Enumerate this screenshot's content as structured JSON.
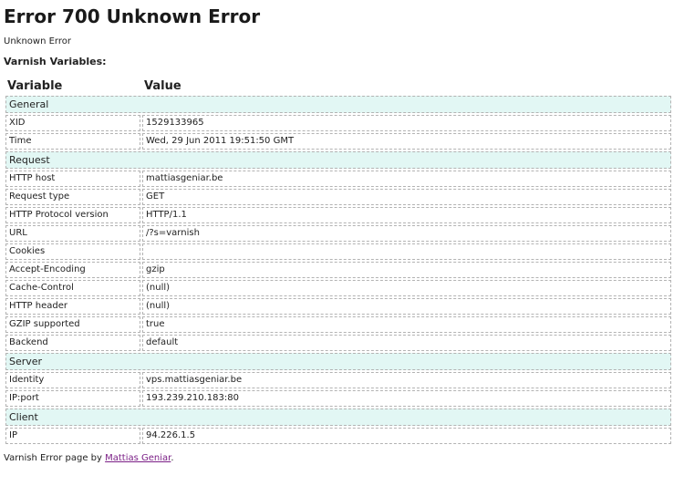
{
  "title": "Error 700 Unknown Error",
  "subtitle": "Unknown Error",
  "vars_heading": "Varnish Variables:",
  "columns": {
    "variable": "Variable",
    "value": "Value"
  },
  "sections": [
    {
      "name": "General",
      "rows": [
        {
          "key": "XID",
          "value": "1529133965"
        },
        {
          "key": "Time",
          "value": "Wed, 29 Jun 2011 19:51:50 GMT"
        }
      ]
    },
    {
      "name": "Request",
      "rows": [
        {
          "key": "HTTP host",
          "value": "mattiasgeniar.be"
        },
        {
          "key": "Request type",
          "value": "GET"
        },
        {
          "key": "HTTP Protocol version",
          "value": "HTTP/1.1"
        },
        {
          "key": "URL",
          "value": "/?s=varnish"
        },
        {
          "key": "Cookies",
          "value": ""
        },
        {
          "key": "Accept-Encoding",
          "value": "gzip"
        },
        {
          "key": "Cache-Control",
          "value": "(null)"
        },
        {
          "key": "HTTP header",
          "value": "(null)"
        },
        {
          "key": "GZIP supported",
          "value": "true"
        },
        {
          "key": "Backend",
          "value": "default"
        }
      ]
    },
    {
      "name": "Server",
      "rows": [
        {
          "key": "Identity",
          "value": "vps.mattiasgeniar.be"
        },
        {
          "key": "IP:port",
          "value": "193.239.210.183:80"
        }
      ]
    },
    {
      "name": "Client",
      "rows": [
        {
          "key": "IP",
          "value": "94.226.1.5"
        }
      ]
    }
  ],
  "footer": {
    "prefix": "Varnish Error page by ",
    "link_text": "Mattias Geniar",
    "suffix": "."
  }
}
